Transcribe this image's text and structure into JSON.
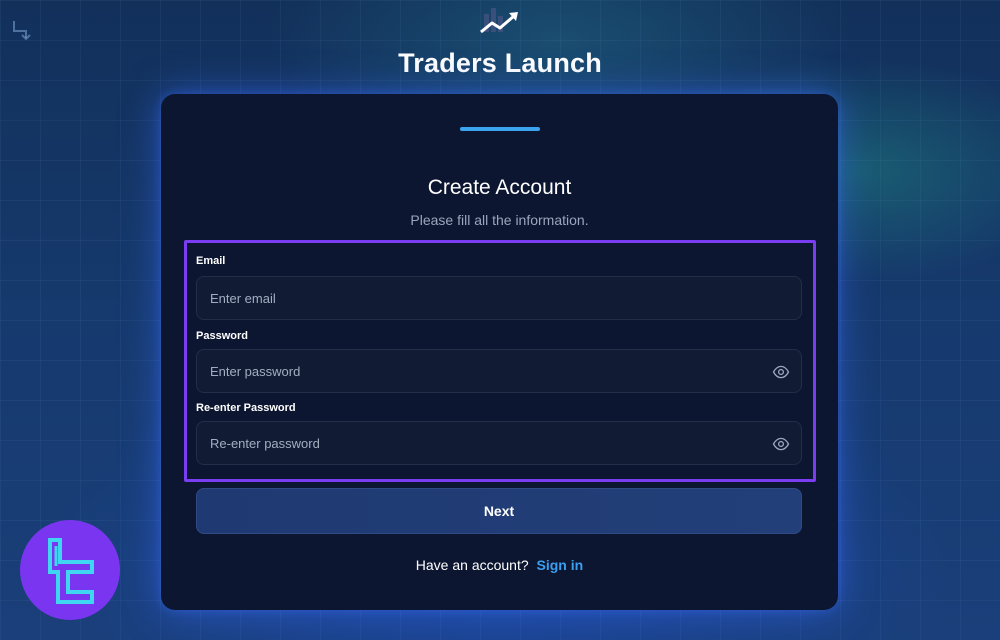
{
  "brand": {
    "name": "Traders Launch",
    "logo_icon": "chart-trend-arrow-icon"
  },
  "form": {
    "title": "Create Account",
    "subtitle": "Please fill all the information.",
    "step_indicator_color": "#3da4f0",
    "highlight_color": "#7b3df2",
    "fields": {
      "email": {
        "label": "Email",
        "placeholder": "Enter email",
        "value": ""
      },
      "password": {
        "label": "Password",
        "placeholder": "Enter password",
        "value": "",
        "toggle_icon": "eye-icon"
      },
      "confirm_password": {
        "label": "Re-enter Password",
        "placeholder": "Re-enter password",
        "value": "",
        "toggle_icon": "eye-icon"
      }
    },
    "next_label": "Next",
    "signin_prompt": "Have an account?",
    "signin_link": "Sign in",
    "link_color": "#3b9ff0"
  },
  "watermark": {
    "icon": "tradingfinder-logo",
    "color": "#7a35f0"
  }
}
